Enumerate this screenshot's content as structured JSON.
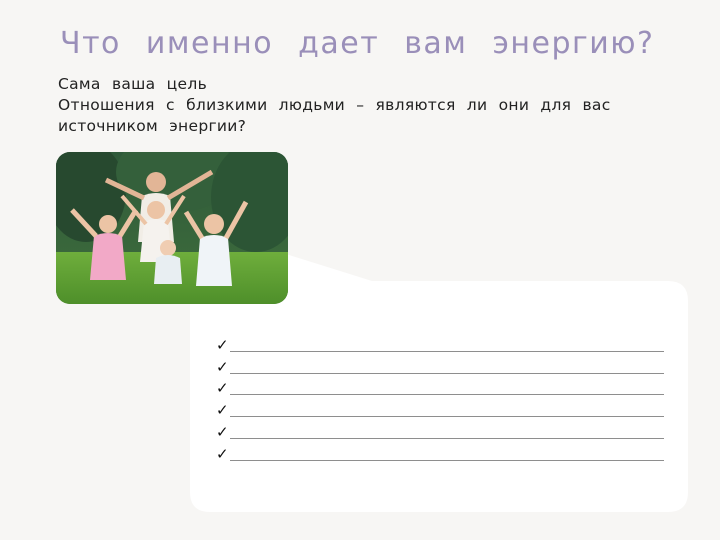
{
  "slide": {
    "title": "Что именно дает вам энергию?",
    "lines": [
      "Сама ваша цель",
      "Отношения с близкими людьми – являются ли они для вас источником энергии?"
    ]
  },
  "photo": {
    "icon": "family-photo"
  },
  "checklist": {
    "mark": "✓",
    "items": [
      "",
      "",
      "",
      "",
      "",
      ""
    ]
  },
  "colors": {
    "title": "#9a8fb9",
    "background": "#f7f6f4",
    "callout": "#ffffff"
  }
}
